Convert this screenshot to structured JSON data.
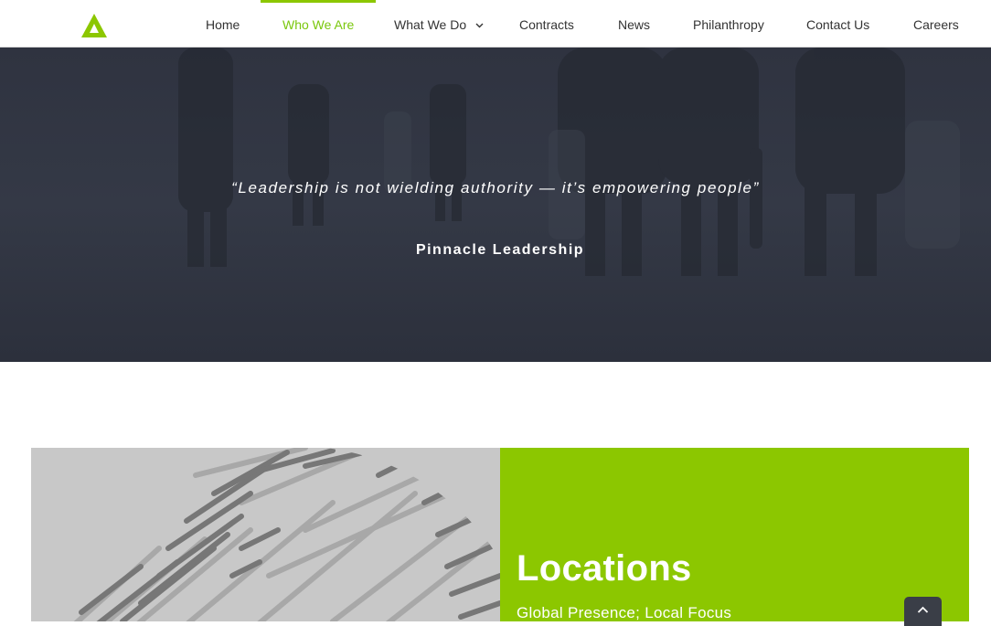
{
  "brand": {
    "logo_icon": "triangle-logo-icon",
    "accent_color": "#8cc700"
  },
  "nav": {
    "items": [
      {
        "label": "Home"
      },
      {
        "label": "Who We Are"
      },
      {
        "label": "What We Do",
        "icon": "chevron-down-icon"
      },
      {
        "label": "Contracts"
      },
      {
        "label": "News"
      },
      {
        "label": "Philanthropy"
      },
      {
        "label": "Contact Us"
      },
      {
        "label": "Careers"
      }
    ],
    "active": "Who We Are",
    "active_color": "#7ac70c"
  },
  "hero": {
    "quote": "“Leadership is not wielding authority — it’s empowering people”",
    "attribution": "Pinnacle Leadership"
  },
  "locations": {
    "title": "Locations",
    "subtitle": "Global Presence; Local Focus",
    "image_icon": "globe-image"
  },
  "scroll_top": {
    "icon": "chevron-up-icon"
  }
}
